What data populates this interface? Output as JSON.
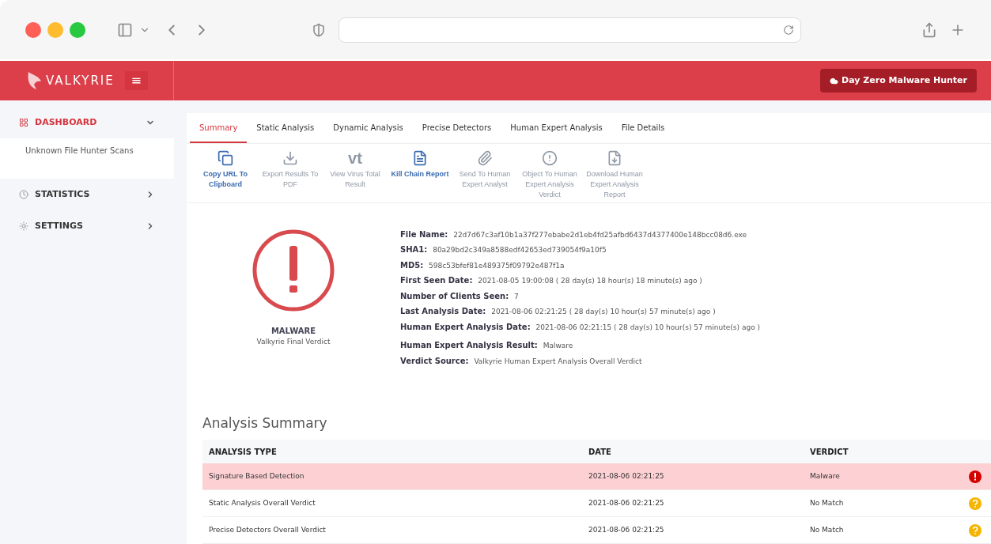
{
  "brand": {
    "name": "VALKYRIE",
    "menu_glyph": "≡"
  },
  "header": {
    "button": "Day Zero Malware Hunter"
  },
  "sidebar": {
    "items": [
      {
        "label": "DASHBOARD",
        "selected": true,
        "expanded": true,
        "children": [
          {
            "label": "Unknown File Hunter Scans"
          }
        ]
      },
      {
        "label": "STATISTICS",
        "selected": false,
        "expanded": false
      },
      {
        "label": "SETTINGS",
        "selected": false,
        "expanded": false
      }
    ]
  },
  "tabs": [
    {
      "label": "Summary",
      "selected": true
    },
    {
      "label": "Static Analysis",
      "selected": false
    },
    {
      "label": "Dynamic Analysis",
      "selected": false
    },
    {
      "label": "Precise Detectors",
      "selected": false
    },
    {
      "label": "Human Expert Analysis",
      "selected": false
    },
    {
      "label": "File Details",
      "selected": false
    }
  ],
  "toolbar": [
    {
      "label": "Copy URL To Clipboard",
      "disabled": false
    },
    {
      "label": "Export Results To PDF",
      "disabled": true
    },
    {
      "glyph": "vt",
      "label": "View Virus Total Result",
      "disabled": true
    },
    {
      "label": "Kill Chain Report",
      "disabled": false
    },
    {
      "label": "Send To Human Expert Analyst",
      "disabled": true
    },
    {
      "label": "Object To Human Expert Analysis Verdict",
      "disabled": true
    },
    {
      "label": "Download Human Expert Analysis Report",
      "disabled": true
    }
  ],
  "verdict": {
    "title": "MALWARE",
    "subtitle": "Valkyrie Final Verdict",
    "kind": "malware"
  },
  "details": [
    {
      "label": "File Name:",
      "value": "22d7d67c3af10b1a37f277ebabe2d1eb4fd25afbd6437d4377400e148bcc08d6.exe"
    },
    {
      "label": "SHA1:",
      "value": "80a29bd2c349a8588edf42653ed739054f9a10f5"
    },
    {
      "label": "MD5:",
      "value": "598c53bfef81e489375f09792e487f1a"
    },
    {
      "label": "First Seen Date:",
      "value": "2021-08-05 19:00:08 ( 28 day(s) 18 hour(s) 18 minute(s) ago )"
    },
    {
      "label": "Number of Clients Seen:",
      "value": "7"
    },
    {
      "label": "Last Analysis Date:",
      "value": "2021-08-06 02:21:25 ( 28 day(s) 10 hour(s) 57 minute(s) ago )"
    },
    {
      "label": "Human Expert Analysis Date:",
      "value": "2021-08-06 02:21:15 ( 28 day(s) 10 hour(s) 57 minute(s) ago )"
    },
    {
      "label": "Human Expert Analysis Result:",
      "value": "Malware"
    },
    {
      "label": "Verdict Source:",
      "value": "Valkyrie Human Expert Analysis Overall Verdict"
    }
  ],
  "summary": {
    "title": "Analysis Summary",
    "columns": [
      "ANALYSIS TYPE",
      "DATE",
      "VERDICT"
    ],
    "rows": [
      {
        "type": "Signature Based Detection",
        "date": "2021-08-06 02:21:25",
        "verdict": "Malware",
        "kind": "malware"
      },
      {
        "type": "Static Analysis Overall Verdict",
        "date": "2021-08-06 02:21:25",
        "verdict": "No Match",
        "kind": "unknown"
      },
      {
        "type": "Precise Detectors Overall Verdict",
        "date": "2021-08-06 02:21:25",
        "verdict": "No Match",
        "kind": "unknown"
      }
    ]
  }
}
